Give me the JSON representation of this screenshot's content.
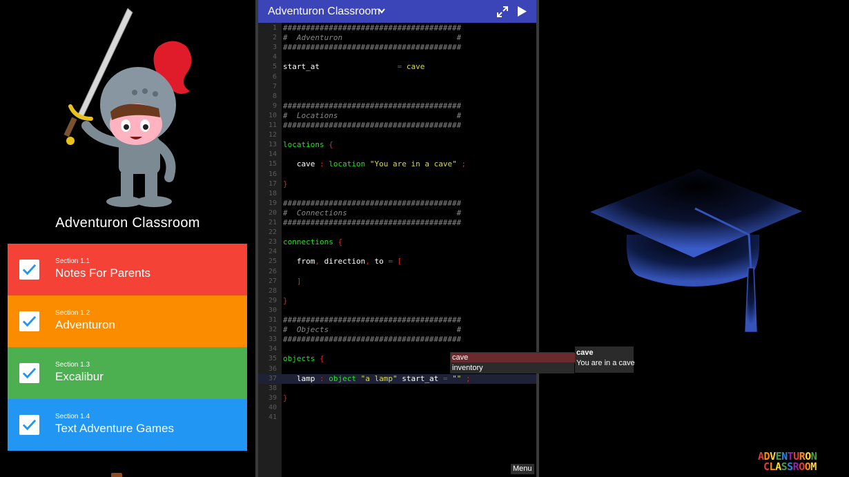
{
  "left_panel": {
    "title": "Adventuron Classroom",
    "sections": [
      {
        "number": "Section 1.1",
        "name": "Notes For Parents",
        "color": "#f44336",
        "completed": true
      },
      {
        "number": "Section 1.2",
        "name": "Adventuron",
        "color": "#fb8c00",
        "completed": true
      },
      {
        "number": "Section 1.3",
        "name": "Excalibur",
        "color": "#4caf50",
        "completed": true
      },
      {
        "number": "Section 1.4",
        "name": "Text Adventure Games",
        "color": "#2196f3",
        "completed": true
      }
    ]
  },
  "editor": {
    "title": "Adventuron Classroom",
    "title_bar_color": "#3b45b8",
    "menu_label": "Menu",
    "active_line": 37,
    "lines": [
      "#######################################",
      "#  Adventuron                         #",
      "#######################################",
      "",
      "start_at                 = cave",
      "",
      "",
      "",
      "#######################################",
      "#  Locations                          #",
      "#######################################",
      "",
      "locations {",
      "",
      "   cave : location \"You are in a cave\" ;",
      "",
      "}",
      "",
      "#######################################",
      "#  Connections                        #",
      "#######################################",
      "",
      "connections {",
      "",
      "   from, direction, to = [",
      "",
      "   ]",
      "",
      "}",
      "",
      "#######################################",
      "#  Objects                            #",
      "#######################################",
      "",
      "objects {",
      "",
      "   lamp : object \"a lamp\" start_at = \"\" ;",
      "",
      "}",
      "",
      ""
    ]
  },
  "autocomplete": {
    "items": [
      "cave",
      "inventory"
    ],
    "selected": "cave",
    "info_title": "cave",
    "info_description": "You are in a cave"
  },
  "branding": {
    "line1": "ADVENTURON",
    "line2": "CLASSROOM"
  },
  "icons": {
    "checkbox": "check-icon",
    "expand": "expand-icon",
    "play": "play-icon",
    "dropdown": "chevron-down-icon"
  }
}
